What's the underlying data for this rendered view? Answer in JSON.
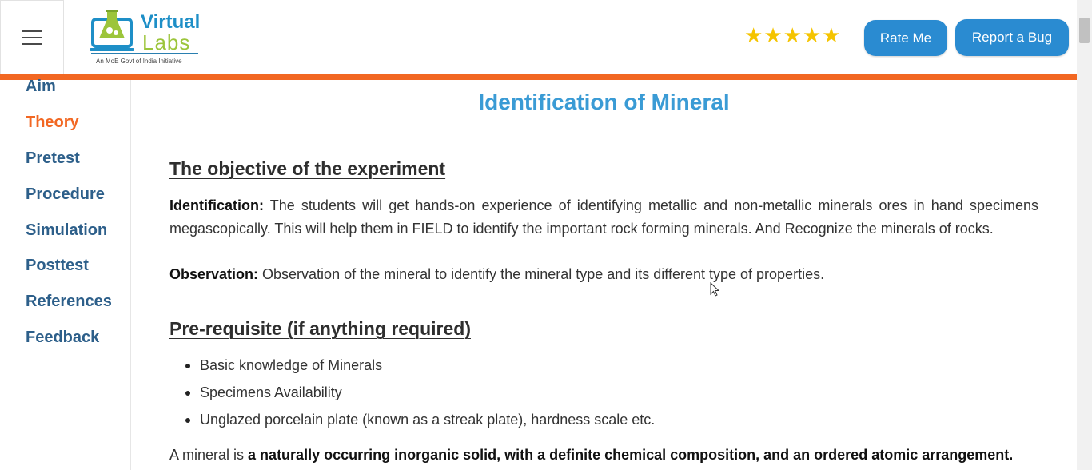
{
  "header": {
    "logo": {
      "word1": "Virtual",
      "word2": "Labs",
      "tagline": "An MoE Govt of India Initiative"
    },
    "rating_stars": 5,
    "rate_label": "Rate Me",
    "bug_label": "Report a Bug"
  },
  "sidebar": {
    "items": [
      {
        "label": "Aim"
      },
      {
        "label": "Theory",
        "active": true
      },
      {
        "label": "Pretest"
      },
      {
        "label": "Procedure"
      },
      {
        "label": "Simulation"
      },
      {
        "label": "Posttest"
      },
      {
        "label": "References"
      },
      {
        "label": "Feedback"
      }
    ]
  },
  "main": {
    "title": "Identification of Mineral",
    "section1": {
      "heading": "The objective of the experiment",
      "identification_label": "Identification:",
      "identification_text": " The students will get hands-on experience of identifying metallic and non-metallic minerals ores in hand specimens megascopically. This will help them in FIELD to identify the important rock forming minerals. And Recognize the minerals of rocks.",
      "observation_label": "Observation:",
      "observation_text": " Observation of the mineral to identify the mineral type and its different type of properties."
    },
    "section2": {
      "heading": "Pre-requisite (if anything required)",
      "items": [
        "Basic knowledge of Minerals",
        "Specimens Availability",
        "Unglazed porcelain plate (known as a streak plate), hardness scale etc."
      ]
    },
    "definition": {
      "prefix": "A mineral is ",
      "bold": "a naturally occurring inorganic solid, with a definite chemical composition, and an ordered atomic arrangement."
    }
  },
  "colors": {
    "accent_orange": "#f26722",
    "button_blue": "#2a8bd1",
    "title_blue": "#3a9bd5",
    "sidebar_text": "#2d5f8a"
  }
}
